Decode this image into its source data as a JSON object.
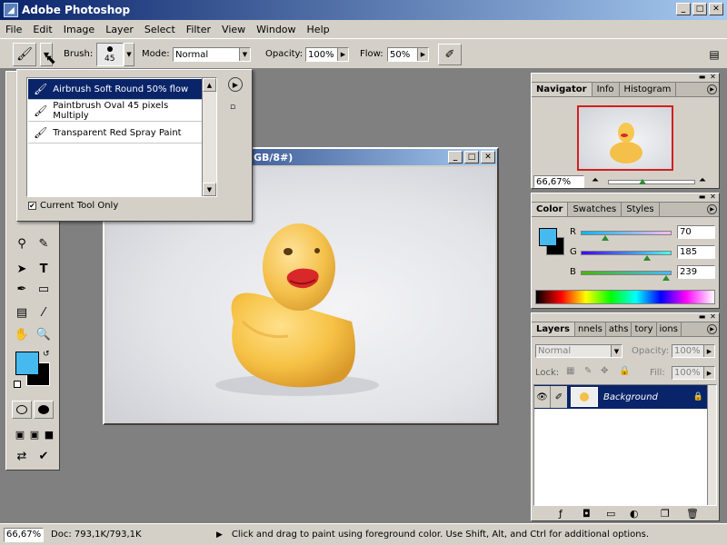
{
  "app": {
    "title": "Adobe Photoshop",
    "icon": "photoshop-icon"
  },
  "menu": [
    "File",
    "Edit",
    "Image",
    "Layer",
    "Select",
    "Filter",
    "View",
    "Window",
    "Help"
  ],
  "options": {
    "brush_label": "Brush:",
    "brush_size": "45",
    "mode_label": "Mode:",
    "mode_value": "Normal",
    "opacity_label": "Opacity:",
    "opacity_value": "100%",
    "flow_label": "Flow:",
    "flow_value": "50%"
  },
  "brush_presets": {
    "items": [
      {
        "label": "Airbrush Soft Round 50% flow",
        "selected": true
      },
      {
        "label": "Paintbrush Oval 45 pixels Multiply",
        "selected": false
      },
      {
        "label": "Transparent Red Spray Paint",
        "selected": false
      }
    ],
    "current_tool_only": "Current Tool Only"
  },
  "document": {
    "title_partial": "GB/8#)"
  },
  "navigator": {
    "tabs": [
      "Navigator",
      "Info",
      "Histogram"
    ],
    "zoom": "66,67%"
  },
  "color": {
    "tabs": [
      "Color",
      "Swatches",
      "Styles"
    ],
    "r_label": "R",
    "r_value": "70",
    "g_label": "G",
    "g_value": "185",
    "b_label": "B",
    "b_value": "239",
    "foreground": "#46b9ef",
    "background": "#000000"
  },
  "layers": {
    "tabs": [
      "Layers",
      "nnels",
      "aths",
      "tory",
      "ions"
    ],
    "blend_mode": "Normal",
    "opacity_label": "Opacity:",
    "opacity_value": "100%",
    "lock_label": "Lock:",
    "fill_label": "Fill:",
    "fill_value": "100%",
    "layer_name": "Background"
  },
  "status": {
    "zoom": "66,67%",
    "doc": "Doc: 793,1K/793,1K",
    "message": "Click and drag to paint using foreground color.  Use Shift, Alt, and Ctrl for additional options."
  }
}
